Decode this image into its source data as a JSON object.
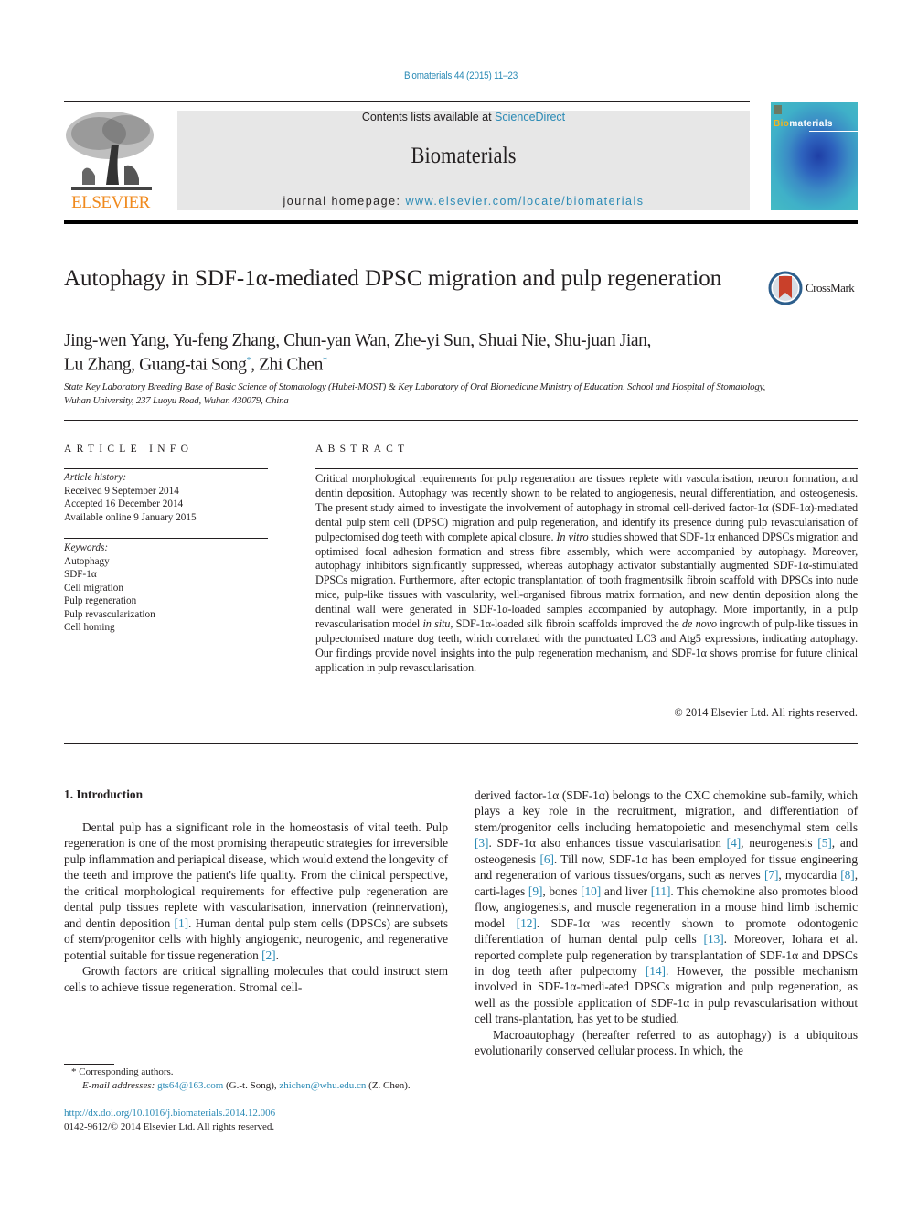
{
  "citation": "Biomaterials 44 (2015) 11–23",
  "publisher": {
    "logo_text": "ELSEVIER",
    "logo_icon": "elsevier-tree-icon"
  },
  "header": {
    "contents_prefix": "Contents lists available at ",
    "contents_link": "ScienceDirect",
    "journal": "Biomaterials",
    "homepage_prefix": "journal homepage: ",
    "homepage_link": "www.elsevier.com/locate/biomaterials"
  },
  "cover": {
    "title_bio": "Bio",
    "title_rest": "materials"
  },
  "colors": {
    "link": "#2a8ab5",
    "elsevier_orange": "#f08a1e",
    "header_box": "#e7e7e7"
  },
  "article": {
    "title": "Autophagy in SDF-1α-mediated DPSC migration and pulp regeneration",
    "crossmark": "CrossMark",
    "authors_line1": "Jing-wen Yang, Yu-feng Zhang, Chun-yan Wan, Zhe-yi Sun, Shuai Nie, Shu-juan Jian,",
    "authors_line2a": "Lu Zhang, Guang-tai Song",
    "authors_line2b": ", Zhi Chen",
    "corresponding_mark": "*",
    "affiliation": "State Key Laboratory Breeding Base of Basic Science of Stomatology (Hubei-MOST) & Key Laboratory of Oral Biomedicine Ministry of Education, School and Hospital of Stomatology, Wuhan University, 237 Luoyu Road, Wuhan 430079, China"
  },
  "article_info": {
    "heading": "ARTICLE INFO",
    "history_label": "Article history:",
    "history": [
      "Received 9 September 2014",
      "Accepted 16 December 2014",
      "Available online 9 January 2015"
    ],
    "keywords_label": "Keywords:",
    "keywords": [
      "Autophagy",
      "SDF-1α",
      "Cell migration",
      "Pulp regeneration",
      "Pulp revascularization",
      "Cell homing"
    ]
  },
  "abstract": {
    "heading": "ABSTRACT",
    "p1": "Critical morphological requirements for pulp regeneration are tissues replete with vascularisation, neuron formation, and dentin deposition. Autophagy was recently shown to be related to angiogenesis, neural differentiation, and osteogenesis. The present study aimed to investigate the involvement of autophagy in stromal cell-derived factor-1α (SDF-1α)-mediated dental pulp stem cell (DPSC) migration and pulp regeneration, and identify its presence during pulp revascularisation of pulpectomised dog teeth with complete apical closure. ",
    "i1": "In vitro",
    "p2": " studies showed that SDF-1α enhanced DPSCs migration and optimised focal adhesion formation and stress fibre assembly, which were accompanied by autophagy. Moreover, autophagy inhibitors significantly suppressed, whereas autophagy activator substantially augmented SDF-1α-stimulated DPSCs migration. Furthermore, after ectopic transplantation of tooth fragment/silk fibroin scaffold with DPSCs into nude mice, pulp-like tissues with vascularity, well-organised fibrous matrix formation, and new dentin deposition along the dentinal wall were generated in SDF-1α-loaded samples accompanied by autophagy. More importantly, in a pulp revascularisation model ",
    "i2": "in situ",
    "p3": ", SDF-1α-loaded silk fibroin scaffolds improved the ",
    "i3": "de novo",
    "p4": " ingrowth of pulp-like tissues in pulpectomised mature dog teeth, which correlated with the punctuated LC3 and Atg5 expressions, indicating autophagy. Our findings provide novel insights into the pulp regeneration mechanism, and SDF-1α shows promise for future clinical application in pulp revascularisation.",
    "copyright": "© 2014 Elsevier Ltd. All rights reserved."
  },
  "intro": {
    "heading": "1.  Introduction",
    "left": {
      "a": "Dental pulp has a significant role in the homeostasis of vital teeth. Pulp regeneration is one of the most promising therapeutic strategies for irreversible pulp inflammation and periapical disease, which would extend the longevity of the teeth and improve the patient's life quality. From the clinical perspective, the critical morphological requirements for effective pulp regeneration are dental pulp tissues replete with vascularisation, innervation (reinnervation), and dentin deposition ",
      "r1": "[1]",
      "b": ". Human dental pulp stem cells (DPSCs) are subsets of stem/progenitor cells with highly angiogenic, neurogenic, and regenerative potential suitable for tissue regeneration ",
      "r2": "[2]",
      "c": ".",
      "p2": "Growth factors are critical signalling molecules that could instruct stem cells to achieve tissue regeneration. Stromal cell-"
    },
    "right": {
      "a": "derived factor-1α (SDF-1α) belongs to the CXC chemokine sub-family, which plays a key role in the recruitment, migration, and differentiation of stem/progenitor cells including hematopoietic and mesenchymal stem cells ",
      "r3": "[3]",
      "b": ". SDF-1α also enhances tissue vascularisation ",
      "r4": "[4]",
      "c": ", neurogenesis ",
      "r5": "[5]",
      "d": ", and osteogenesis ",
      "r6": "[6]",
      "e": ". Till now, SDF-1α has been employed for tissue engineering and regeneration of various tissues/organs, such as nerves ",
      "r7": "[7]",
      "f": ", myocardia ",
      "r8": "[8]",
      "g": ", carti-lages ",
      "r9": "[9]",
      "h": ", bones ",
      "r10": "[10]",
      "i": " and liver ",
      "r11": "[11]",
      "j": ". This chemokine also promotes blood flow, angiogenesis, and muscle regeneration in a mouse hind limb ischemic model ",
      "r12": "[12]",
      "k": ". SDF-1α was recently shown to promote odontogenic differentiation of human dental pulp cells ",
      "r13": "[13]",
      "l": ". Moreover, Iohara et al. reported complete pulp regeneration by transplantation of SDF-1α and DPSCs in dog teeth after pulpectomy ",
      "r14": "[14]",
      "m": ". However, the possible mechanism involved in SDF-1α-medi-ated DPSCs migration and pulp regeneration, as well as the possible application of SDF-1α in pulp revascularisation without cell trans-plantation, has yet to be studied.",
      "p2": "Macroautophagy (hereafter referred to as autophagy) is a ubiquitous evolutionarily conserved cellular process. In which, the"
    }
  },
  "footnote": {
    "corresponding": "*  Corresponding authors.",
    "email_label": "E-mail addresses: ",
    "email1": "gts64@163.com",
    "email1_name": " (G.-t. Song), ",
    "email2": "zhichen@whu.edu.cn",
    "email2_name": " (Z. Chen)."
  },
  "doi": {
    "link": "http://dx.doi.org/10.1016/j.biomaterials.2014.12.006",
    "issn": "0142-9612/© 2014 Elsevier Ltd. All rights reserved."
  }
}
